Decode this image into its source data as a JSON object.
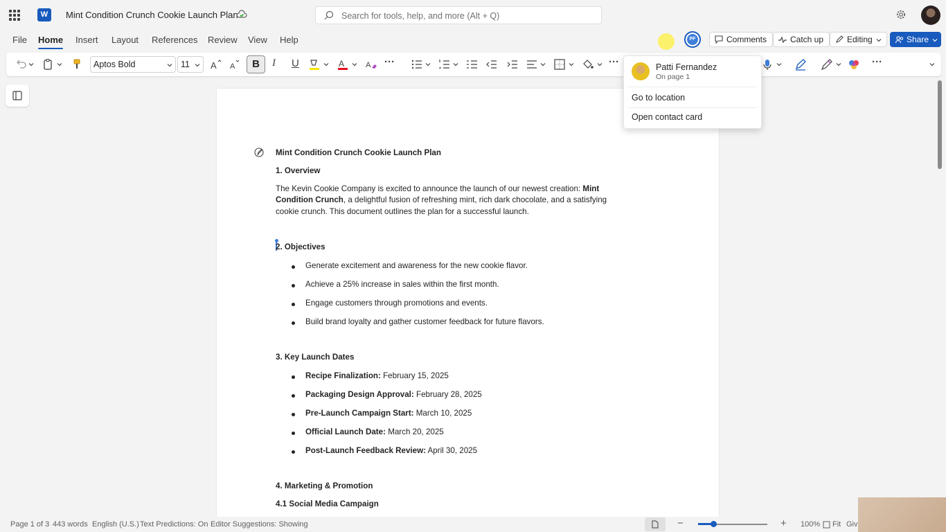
{
  "app": {
    "doc_title": "Mint Condition Crunch Cookie Launch Plan",
    "app_logo_letter": "W",
    "search_placeholder": "Search for tools, help, and more (Alt + Q)"
  },
  "tabs": [
    "File",
    "Home",
    "Insert",
    "Layout",
    "References",
    "Review",
    "View",
    "Help"
  ],
  "active_tab": "Home",
  "header_buttons": {
    "presence_initials": "PF",
    "comments": "Comments",
    "catch_up": "Catch up",
    "editing": "Editing",
    "share": "Share"
  },
  "toolbar": {
    "font_name": "Aptos Bold",
    "font_size": "11",
    "bold_label": "B",
    "italic_label": "I",
    "underline_label": "U",
    "more_label": "···"
  },
  "presence_popup": {
    "name": "Patti Fernandez",
    "location": "On page 1",
    "items": [
      "Go to location",
      "Open contact card"
    ]
  },
  "document": {
    "title": "Mint Condition Crunch Cookie Launch Plan",
    "sections": {
      "overview_heading": "1. Overview",
      "overview_text_1": "The Kevin Cookie Company is excited to announce the launch of our newest creation: ",
      "overview_bold_1": "Mint",
      "overview_bold_2": "Condition Crunch",
      "overview_text_2": ", a delightful fusion of refreshing mint, rich dark chocolate, and a satisfying",
      "overview_text_3": "cookie crunch. This document outlines the plan for a successful launch.",
      "objectives_heading": "2. Objectives",
      "objectives": [
        "Generate excitement and awareness for the new cookie flavor.",
        "Achieve a 25% increase in sales within the first month.",
        "Engage customers through promotions and events.",
        "Build brand loyalty and gather customer feedback for future flavors."
      ],
      "dates_heading": "3. Key Launch Dates",
      "dates": [
        {
          "label": "Recipe Finalization:",
          "value": " February 15, 2025"
        },
        {
          "label": "Packaging Design Approval:",
          "value": " February 28, 2025"
        },
        {
          "label": "Pre-Launch Campaign Start:",
          "value": " March 10, 2025"
        },
        {
          "label": "Official Launch Date:",
          "value": " March 20, 2025"
        },
        {
          "label": "Post-Launch Feedback Review:",
          "value": " April 30, 2025"
        }
      ],
      "marketing_heading": "4. Marketing & Promotion",
      "social_heading": "4.1 Social Media Campaign"
    }
  },
  "status_bar": {
    "page": "Page 1 of 3",
    "words": "443 words",
    "language": "English (U.S.)",
    "text_predictions": "Text Predictions: On",
    "editor_suggestions": "Editor Suggestions: Showing",
    "zoom": "100%",
    "fit": "Fit",
    "feedback_partial": "Giv"
  },
  "colors": {
    "accent": "#185abd",
    "presence": "#3f7fd9"
  }
}
